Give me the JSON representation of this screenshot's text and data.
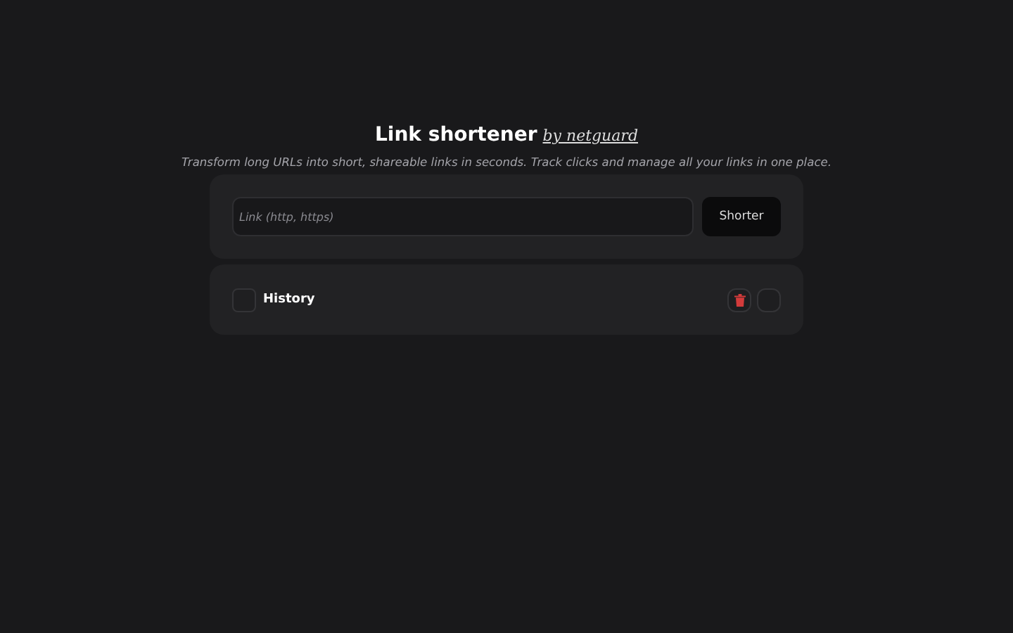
{
  "header": {
    "title": "Link shortener",
    "byline": "by netguard",
    "subtitle": "Transform long URLs into short, shareable links in seconds. Track clicks and manage all your links in one place."
  },
  "form": {
    "placeholder": "Link (http, https)",
    "button": "Shorter"
  },
  "history": {
    "label": "History",
    "checked": false
  }
}
